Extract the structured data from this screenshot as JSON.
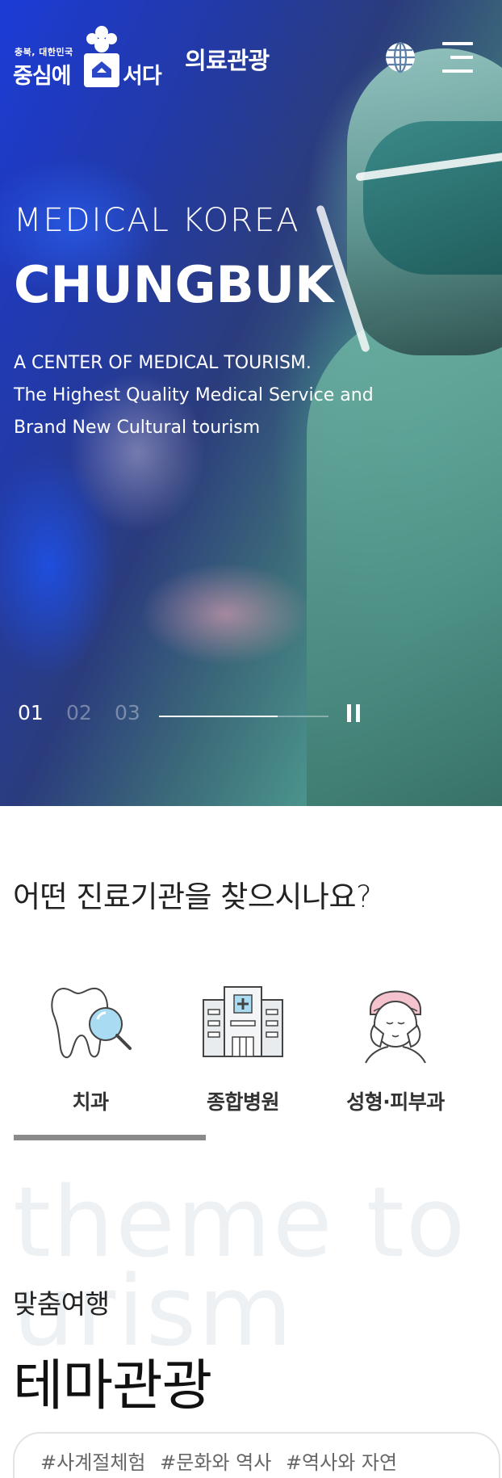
{
  "header": {
    "logo_small": "충북, 대한민국",
    "logo_left": "중심에",
    "logo_right": "서다",
    "title": "의료관광",
    "globe_icon": "globe-icon",
    "menu_icon": "hamburger-menu-icon"
  },
  "hero": {
    "subtitle": "MEDICAL KOREA",
    "title": "CHUNGBUK",
    "desc_line1": "A CENTER OF MEDICAL TOURISM.",
    "desc_line2": "The Highest Quality Medical Service and",
    "desc_line3": "Brand New Cultural tourism",
    "slides": [
      "01",
      "02",
      "03"
    ],
    "active_slide": 1,
    "progress": 0.7
  },
  "search": {
    "question": "어떤 진료기관을 찾으시나요?",
    "categories": [
      {
        "label": "치과",
        "icon": "tooth-icon"
      },
      {
        "label": "종합병원",
        "icon": "hospital-icon"
      },
      {
        "label": "성형·피부과",
        "icon": "face-care-icon"
      }
    ]
  },
  "theme": {
    "bg_text": "theme tourism",
    "sub": "맞춤여행",
    "title": "테마관광",
    "tags": [
      "#사계절체험",
      "#문화와 역사",
      "#역사와 자연"
    ]
  },
  "colors": {
    "hero_blue": "#1c3bd6",
    "hero_teal": "#4d9a8f",
    "indicator": "#8a8a8a",
    "bg_text": "#eef1f4"
  }
}
